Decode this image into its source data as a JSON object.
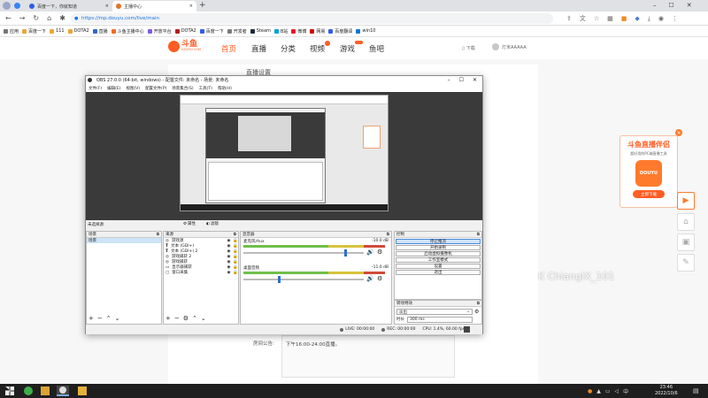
{
  "browser": {
    "tabs": [
      {
        "label": "百度一下，你就知道",
        "favicon_color": "#2d5ee8"
      },
      {
        "label": "主播中心",
        "favicon_color": "#e8702a"
      }
    ],
    "new_tab_symbol": "+",
    "url": "https://mp.douyu.com/live/main",
    "bookmarks": [
      "百度一下",
      "111",
      "DOTA2",
      "直播",
      "斗鱼主播中心",
      "开放平台",
      "DOTA2",
      "百度一下",
      "开发者",
      "Steam",
      "B站",
      "微博",
      "网易",
      "百度翻译",
      "win10",
      "翻译",
      "设置"
    ],
    "apps_label": "应用"
  },
  "douyu": {
    "logo_text": "斗鱼",
    "logo_sub": "DOUYU.COM",
    "nav": [
      "首页",
      "直播",
      "分类",
      "视频",
      "游戏",
      "鱼吧"
    ],
    "download_label": "下载",
    "user_name": "灯米AAAAA",
    "center_heading": "直播设置",
    "notice_label": "房间公告:",
    "notice_text": "下午16:00-24:00直播。",
    "accent": "#ff5d23"
  },
  "obs": {
    "title": "OBS 27.0.0 (64-bit, windows) - 配置文件: 未命名 - 场景: 未命名",
    "menu": [
      "文件(F)",
      "编辑(E)",
      "视图(V)",
      "配置文件(P)",
      "场景集合(S)",
      "工具(T)",
      "帮助(H)"
    ],
    "no_source_label": "未选择源",
    "props_label": "属性",
    "filters_label": "滤镜",
    "docks": {
      "scenes": {
        "title": "场景",
        "items": [
          "场景"
        ]
      },
      "sources": {
        "title": "来源",
        "items": [
          "游戏源",
          "文本 (GDI+)",
          "文本 (GDI+) 2",
          "游戏捕获 2",
          "游戏捕获",
          "显示器捕获",
          "窗口采集"
        ]
      },
      "mixer": {
        "title": "混音器",
        "tracks": [
          {
            "name": "麦克风/Aux",
            "db": "-10.0 dB",
            "level": 0.85
          },
          {
            "name": "桌面音频",
            "db": "-11.0 dB",
            "level": 0.3
          }
        ]
      },
      "controls": {
        "title": "控制",
        "buttons": [
          "停止推流",
          "开始录制",
          "启动虚拟摄像机",
          "工作室模式",
          "设置",
          "退出"
        ]
      },
      "transitions": {
        "title": "转场特效",
        "selected": "淡出",
        "duration_label": "时长",
        "duration_value": "300 ms"
      }
    },
    "status": {
      "live": "LIVE: 00:00:00",
      "rec": "REC: 00:00:00",
      "cpu": "CPU: 1.4%, 60.00 fps"
    }
  },
  "ad": {
    "title": "斗鱼直播伴侣",
    "subtitle": "超好用的PC端直播工具",
    "brand": "DOUYU",
    "button": "立即下载"
  },
  "watermark": "K ChiangIX_101",
  "taskbar": {
    "time": "23:46",
    "date": "2022/10/6"
  }
}
